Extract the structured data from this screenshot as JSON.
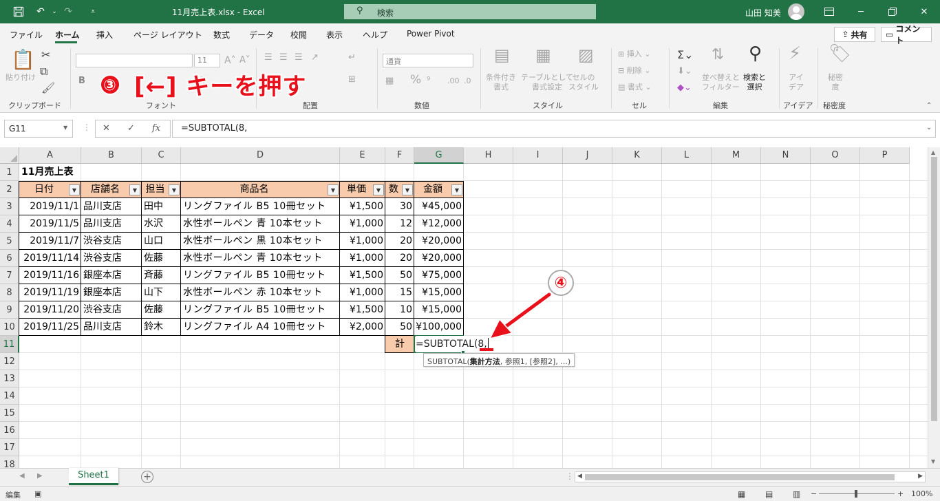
{
  "titlebar": {
    "doc_title": "11月売上表.xlsx  -  Excel",
    "search_placeholder": "検索",
    "user_name": "山田 知美"
  },
  "tabs": [
    "ファイル",
    "ホーム",
    "挿入",
    "ページ レイアウト",
    "数式",
    "データ",
    "校閲",
    "表示",
    "ヘルプ",
    "Power Pivot"
  ],
  "active_tab": "ホーム",
  "share_label": "共有",
  "comment_label": "コメント",
  "ribbon": {
    "groups": [
      "クリップボード",
      "フォント",
      "配置",
      "数値",
      "スタイル",
      "セル",
      "編集",
      "アイデア",
      "秘密度"
    ],
    "paste_label": "貼り付け",
    "font_size": "11",
    "number_format": "通貨",
    "cond_format": "条件付き\n書式",
    "table_format": "テーブルとして\n書式設定",
    "cell_style": "セルの\nスタイル",
    "insert": "挿入",
    "delete": "削除",
    "format": "書式",
    "sort_filter": "並べ替えと\nフィルター",
    "find_select": "検索と\n選択",
    "ideas": "アイ\nデア",
    "sensitivity": "秘密\n度"
  },
  "namebox": "G11",
  "formula": "=SUBTOTAL(8,",
  "columns": [
    "A",
    "B",
    "C",
    "D",
    "E",
    "F",
    "G",
    "H",
    "I",
    "J",
    "K",
    "L",
    "M",
    "N",
    "O",
    "P"
  ],
  "rows": [
    "1",
    "2",
    "3",
    "4",
    "5",
    "6",
    "7",
    "8",
    "9",
    "10",
    "11",
    "12",
    "13",
    "14",
    "15",
    "16",
    "17",
    "18"
  ],
  "sheet": {
    "title": "11月売上表",
    "headers": [
      "日付",
      "店舗名",
      "担当者",
      "商品名",
      "単価",
      "数量",
      "金額"
    ],
    "header_visible": [
      "日付",
      "店舗名",
      "担当",
      "商品名",
      "単価",
      "数",
      "金額"
    ],
    "data": [
      [
        "2019/11/1",
        "品川支店",
        "田中",
        "リングファイル B5 10冊セット",
        "¥1,500",
        "30",
        "¥45,000"
      ],
      [
        "2019/11/5",
        "品川支店",
        "水沢",
        "水性ボールペン 青 10本セット",
        "¥1,000",
        "12",
        "¥12,000"
      ],
      [
        "2019/11/7",
        "渋谷支店",
        "山口",
        "水性ボールペン 黒 10本セット",
        "¥1,000",
        "20",
        "¥20,000"
      ],
      [
        "2019/11/14",
        "渋谷支店",
        "佐藤",
        "水性ボールペン 青 10本セット",
        "¥1,000",
        "20",
        "¥20,000"
      ],
      [
        "2019/11/16",
        "銀座本店",
        "斉藤",
        "リングファイル B5 10冊セット",
        "¥1,500",
        "50",
        "¥75,000"
      ],
      [
        "2019/11/19",
        "銀座本店",
        "山下",
        "水性ボールペン 赤 10本セット",
        "¥1,000",
        "15",
        "¥15,000"
      ],
      [
        "2019/11/20",
        "渋谷支店",
        "佐藤",
        "リングファイル B5 10冊セット",
        "¥1,500",
        "10",
        "¥15,000"
      ],
      [
        "2019/11/25",
        "品川支店",
        "鈴木",
        "リングファイル A4 10冊セット",
        "¥2,000",
        "50",
        "¥100,000"
      ]
    ],
    "total_label": "計",
    "editing_formula": "=SUBTOTAL(8,",
    "tooltip_fn": "SUBTOTAL(",
    "tooltip_arg": "集計方法",
    "tooltip_rest": ", 参照1, [参照2], ...)"
  },
  "annotation": {
    "step3_num": "③",
    "step3_text": "[←] キーを押す",
    "step4_num": "④"
  },
  "sheet_tab": "Sheet1",
  "status": {
    "mode": "編集",
    "zoom": "100%"
  },
  "colors": {
    "excel_green": "#217346",
    "header_fill": "#f8cbad",
    "annotation_red": "#e8101a"
  }
}
